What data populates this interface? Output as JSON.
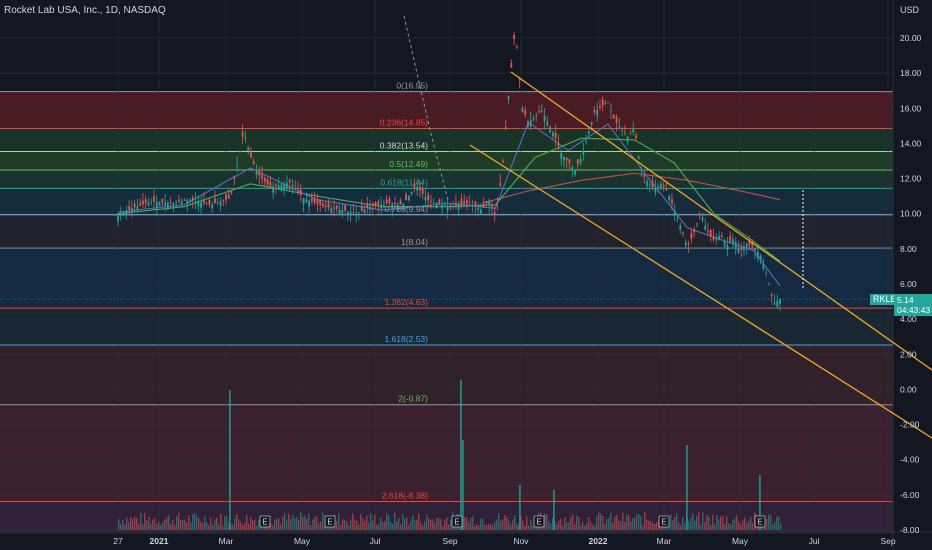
{
  "header": {
    "title": "Rocket Lab USA, Inc., 1D, NASDAQ",
    "currency": "USD"
  },
  "last_price": {
    "symbol": "RKLB",
    "price": "5.14",
    "countdown": "04:43:43"
  },
  "chart_data": {
    "type": "candlestick",
    "title": "Rocket Lab USA, Inc., 1D, NASDAQ",
    "y_ticks": [
      "20.00",
      "18.00",
      "16.00",
      "14.00",
      "12.00",
      "10.00",
      "8.00",
      "6.00",
      "4.00",
      "2.00",
      "0.00",
      "-2.00",
      "-4.00",
      "-6.00",
      "-8.00"
    ],
    "ylim": [
      -8.2,
      21.5
    ],
    "x_ticks": [
      "27",
      "2021",
      "Mar",
      "May",
      "Jul",
      "Sep",
      "Nov",
      "2022",
      "Mar",
      "May",
      "Jul",
      "Sep"
    ],
    "grid": true,
    "fib_levels": [
      {
        "label": "0(16.95)",
        "value": 16.95,
        "line_color": "#9598a1",
        "fill": "#7a1f26",
        "text_color": "#9598a1"
      },
      {
        "label": "0.236(14.85)",
        "value": 14.85,
        "line_color": "#f44336",
        "fill": "#1d4a2b",
        "text_color": "#f44336"
      },
      {
        "label": "0.382(13.54)",
        "value": 13.54,
        "line_color": "#a5d6a7",
        "fill": "#2a5b2e",
        "text_color": "#d1d4dc"
      },
      {
        "label": "0.5(12.49)",
        "value": 12.49,
        "line_color": "#66bb6a",
        "fill": "#1f4a3a",
        "text_color": "#66bb6a"
      },
      {
        "label": "0.618(11.44)",
        "value": 11.44,
        "line_color": "#26a69a",
        "fill": "#163e52",
        "text_color": "#26a69a"
      },
      {
        "label": "0.786(9.94)",
        "value": 9.94,
        "line_color": "#90caf9",
        "fill": "#2a2e39",
        "text_color": "#9598a1"
      },
      {
        "label": "1(8.04)",
        "value": 8.04,
        "line_color": "#9598a1",
        "fill": "#163a5c",
        "text_color": "#9598a1"
      },
      {
        "label": "1.382(4.63)",
        "value": 4.63,
        "line_color": "#f44336",
        "fill": "#1f3440",
        "text_color": "#f44336"
      },
      {
        "label": "1.618(2.53)",
        "value": 2.53,
        "line_color": "#42a5f5",
        "fill": "#4a2a32",
        "text_color": "#42a5f5"
      },
      {
        "label": "2(-0.87)",
        "value": -0.87,
        "line_color": "#9598a1",
        "fill": "#5c2a3a",
        "text_color": "#66bb6a"
      },
      {
        "label": "2.618(-6.38)",
        "value": -6.38,
        "line_color": "#f44336",
        "fill": "#4a2a4a",
        "text_color": "#f44336"
      }
    ],
    "price_path": [
      [
        0.0,
        9.9
      ],
      [
        0.02,
        10.3
      ],
      [
        0.05,
        10.7
      ],
      [
        0.08,
        10.6
      ],
      [
        0.11,
        10.8
      ],
      [
        0.14,
        10.5
      ],
      [
        0.17,
        10.9
      ],
      [
        0.19,
        14.7
      ],
      [
        0.2,
        13.3
      ],
      [
        0.21,
        12.3
      ],
      [
        0.23,
        11.5
      ],
      [
        0.26,
        11.8
      ],
      [
        0.28,
        10.9
      ],
      [
        0.31,
        10.4
      ],
      [
        0.34,
        10.2
      ],
      [
        0.36,
        10.0
      ],
      [
        0.38,
        10.4
      ],
      [
        0.41,
        10.6
      ],
      [
        0.43,
        10.5
      ],
      [
        0.45,
        11.6
      ],
      [
        0.47,
        10.7
      ],
      [
        0.5,
        10.4
      ],
      [
        0.53,
        10.6
      ],
      [
        0.55,
        10.2
      ],
      [
        0.56,
        10.8
      ],
      [
        0.57,
        9.9
      ],
      [
        0.58,
        12.2
      ],
      [
        0.59,
        16.7
      ],
      [
        0.6,
        20.6
      ],
      [
        0.61,
        16.1
      ],
      [
        0.62,
        15.2
      ],
      [
        0.64,
        15.9
      ],
      [
        0.66,
        14.4
      ],
      [
        0.67,
        13.4
      ],
      [
        0.69,
        12.5
      ],
      [
        0.7,
        13.2
      ],
      [
        0.72,
        15.8
      ],
      [
        0.74,
        16.4
      ],
      [
        0.75,
        15.3
      ],
      [
        0.77,
        14.4
      ],
      [
        0.78,
        14.9
      ],
      [
        0.79,
        12.4
      ],
      [
        0.8,
        11.8
      ],
      [
        0.81,
        11.4
      ],
      [
        0.82,
        11.7
      ],
      [
        0.83,
        11.3
      ],
      [
        0.84,
        10.2
      ],
      [
        0.85,
        9.3
      ],
      [
        0.86,
        8.1
      ],
      [
        0.87,
        8.9
      ],
      [
        0.88,
        10.1
      ],
      [
        0.89,
        9.0
      ],
      [
        0.9,
        8.5
      ],
      [
        0.91,
        8.8
      ],
      [
        0.92,
        8.2
      ],
      [
        0.93,
        8.6
      ],
      [
        0.94,
        7.9
      ],
      [
        0.95,
        8.3
      ],
      [
        0.96,
        8.1
      ],
      [
        0.97,
        7.7
      ],
      [
        0.98,
        6.5
      ],
      [
        0.99,
        4.9
      ],
      [
        1.0,
        5.14
      ]
    ],
    "date_span": [
      "27",
      "2022 May"
    ],
    "price_x_range": [
      118,
      780
    ],
    "ma_fast": [
      [
        0.0,
        10.1
      ],
      [
        0.1,
        10.5
      ],
      [
        0.2,
        12.6
      ],
      [
        0.3,
        10.8
      ],
      [
        0.4,
        10.2
      ],
      [
        0.5,
        10.6
      ],
      [
        0.57,
        10.3
      ],
      [
        0.62,
        15.2
      ],
      [
        0.68,
        13.6
      ],
      [
        0.74,
        15.1
      ],
      [
        0.8,
        12.1
      ],
      [
        0.86,
        9.2
      ],
      [
        0.92,
        8.4
      ],
      [
        0.96,
        7.9
      ],
      [
        1.0,
        5.9
      ]
    ],
    "ma_mid": [
      [
        0.0,
        10.0
      ],
      [
        0.1,
        10.4
      ],
      [
        0.2,
        11.7
      ],
      [
        0.3,
        11.0
      ],
      [
        0.4,
        10.4
      ],
      [
        0.5,
        10.4
      ],
      [
        0.57,
        10.5
      ],
      [
        0.63,
        13.2
      ],
      [
        0.7,
        14.3
      ],
      [
        0.78,
        14.2
      ],
      [
        0.84,
        12.9
      ],
      [
        0.9,
        10.0
      ],
      [
        0.95,
        8.7
      ],
      [
        1.0,
        7.3
      ]
    ],
    "ma_slow": [
      [
        0.55,
        10.6
      ],
      [
        0.62,
        11.3
      ],
      [
        0.7,
        11.9
      ],
      [
        0.78,
        12.3
      ],
      [
        0.86,
        11.9
      ],
      [
        0.94,
        11.3
      ],
      [
        1.0,
        10.8
      ]
    ],
    "channel": {
      "upper": [
        [
          511,
          72
        ],
        [
          932,
          370
        ]
      ],
      "lower": [
        [
          470,
          145
        ],
        [
          932,
          438
        ]
      ]
    },
    "volume_spikes": [
      {
        "x": 229,
        "h": 140
      },
      {
        "x": 460,
        "h": 150
      },
      {
        "x": 462,
        "h": 90
      },
      {
        "x": 686,
        "h": 85
      },
      {
        "x": 519,
        "h": 45
      },
      {
        "x": 553,
        "h": 40
      },
      {
        "x": 759,
        "h": 55
      }
    ],
    "earnings": [
      {
        "x": 265,
        "label": "E"
      },
      {
        "x": 330,
        "label": "E"
      },
      {
        "x": 457,
        "label": "E"
      },
      {
        "x": 539,
        "label": "E"
      },
      {
        "x": 664,
        "label": "E"
      },
      {
        "x": 760,
        "label": "E"
      }
    ]
  }
}
